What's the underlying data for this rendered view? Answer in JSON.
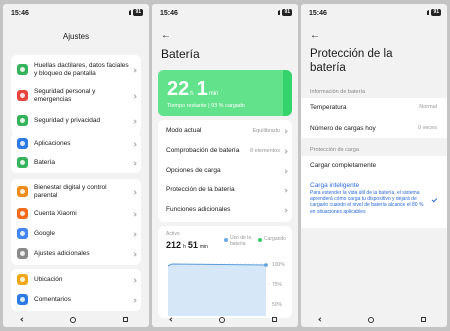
{
  "status": {
    "time": "15:46",
    "battery": "91"
  },
  "panel1": {
    "title": "Ajustes",
    "items": [
      {
        "label": "Huellas dactilares, datos faciales y bloqueo de pantalla",
        "icon": "fingerprint-icon",
        "color": "#35b35a"
      },
      {
        "label": "Seguridad personal y emergencias",
        "icon": "emergency-icon",
        "color": "#e8453c"
      },
      {
        "label": "Seguridad y privacidad",
        "icon": "shield-icon",
        "color": "#35b35a"
      },
      {
        "label": "Aplicaciones",
        "icon": "apps-icon",
        "color": "#2c7be5"
      },
      {
        "label": "Batería",
        "icon": "battery-icon",
        "color": "#35b35a"
      },
      {
        "label": "Bienestar digital y control parental",
        "icon": "wellbeing-icon",
        "color": "#f08c1a"
      },
      {
        "label": "Cuenta Xiaomi",
        "icon": "xiaomi-icon",
        "color": "#f26a1b"
      },
      {
        "label": "Google",
        "icon": "google-icon",
        "color": "#4285f4"
      },
      {
        "label": "Ajustes adicionales",
        "icon": "gear-icon",
        "color": "#8a8a8a"
      },
      {
        "label": "Ubicación",
        "icon": "location-icon",
        "color": "#f0a81a"
      },
      {
        "label": "Comentarios",
        "icon": "feedback-icon",
        "color": "#2c7be5"
      }
    ]
  },
  "panel2": {
    "title": "Batería",
    "hours": "22",
    "hours_unit": "h",
    "minutes": "1",
    "minutes_unit": "min",
    "subtitle": "Tiempo restante | 93 % cargado",
    "level": 0.93,
    "items": [
      {
        "label": "Modo actual",
        "value": "Equilibrado"
      },
      {
        "label": "Comprobación de batería",
        "value": "8 elementos"
      },
      {
        "label": "Opciones de carga",
        "value": ""
      },
      {
        "label": "Protección de la batería",
        "value": ""
      },
      {
        "label": "Funciones adicionales",
        "value": ""
      }
    ],
    "chart": {
      "label": "Activo",
      "hours": "212",
      "hours_unit": "h",
      "minutes": "51",
      "minutes_unit": "min",
      "legend_life": "Uso de la batería",
      "legend_charging": "Cargando",
      "ticks": [
        "100%",
        "75%",
        "50%"
      ]
    }
  },
  "panel3": {
    "title_line1": "Protección de la",
    "title_line2": "batería",
    "section1": "Información de batería",
    "temp_label": "Temperatura",
    "temp_value": "Normal",
    "cycles_label": "Número de cargas hoy",
    "cycles_value": "0 veces",
    "section2": "Protección de carga",
    "full_label": "Cargar completamente",
    "smart_label": "Carga inteligente",
    "smart_desc": "Para extender la vida útil de la batería, el sistema aprenderá cómo carga tu dispositivo y dejará de cargarlo cuando el nivel de batería alcance el 80 % en situaciones aplicables"
  }
}
